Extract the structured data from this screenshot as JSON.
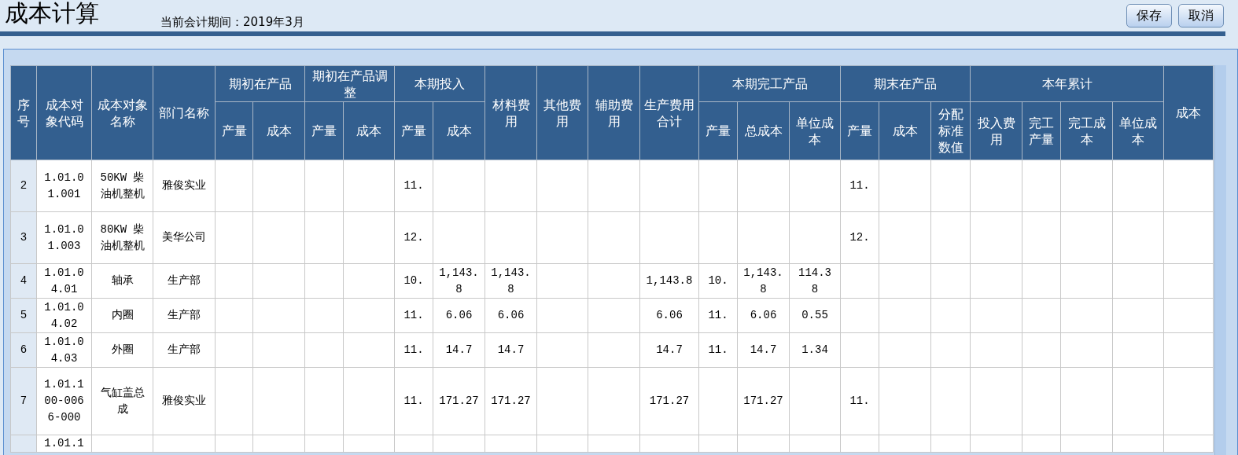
{
  "title": "成本计算",
  "period": "当前会计期间：2019年3月",
  "buttons": [
    "保存",
    "取消"
  ],
  "table": {
    "header": [
      {
        "label": "序号"
      },
      {
        "label": "成本对象代码"
      },
      {
        "label": "成本对象名称"
      },
      {
        "label": "部门名称"
      },
      {
        "label": "期初在产品",
        "children": [
          "产量",
          "成本"
        ]
      },
      {
        "label": "期初在产品调整",
        "children": [
          "产量",
          "成本"
        ]
      },
      {
        "label": "本期投入",
        "children": [
          "产量",
          "成本"
        ]
      },
      {
        "label": "材料费用"
      },
      {
        "label": "其他费用"
      },
      {
        "label": "辅助费用"
      },
      {
        "label": "生产费用合计"
      },
      {
        "label": "本期完工产品",
        "children": [
          "产量",
          "总成本",
          "单位成本"
        ]
      },
      {
        "label": "期末在产品",
        "children": [
          "产量",
          "成本",
          "分配标准数值"
        ]
      },
      {
        "label": "本年累计",
        "children": [
          "投入费用",
          "完工产量",
          "完工成本",
          "单位成本"
        ]
      },
      {
        "label": "成本"
      }
    ],
    "rows": [
      {
        "cells": [
          "2",
          "1.01.01.001",
          "50KW 柴油机整机",
          "雅俊实业",
          null,
          null,
          null,
          null,
          "11.",
          null,
          null,
          null,
          null,
          null,
          null,
          null,
          null,
          "11.",
          null,
          null,
          null,
          null,
          null,
          null,
          null
        ]
      },
      {
        "cells": [
          "3",
          "1.01.01.003",
          "80KW 柴油机整机",
          "美华公司",
          null,
          null,
          null,
          null,
          "12.",
          null,
          null,
          null,
          null,
          null,
          null,
          null,
          null,
          "12.",
          null,
          null,
          null,
          null,
          null,
          null,
          null
        ]
      },
      {
        "cells": [
          "4",
          "1.01.04.01",
          "轴承",
          "生产部",
          null,
          null,
          null,
          null,
          "10.",
          "1,143.8",
          "1,143.8",
          null,
          null,
          "1,143.8",
          "10.",
          "1,143.8",
          "114.38",
          null,
          null,
          null,
          null,
          null,
          null,
          null,
          null
        ]
      },
      {
        "cells": [
          "5",
          "1.01.04.02",
          "内圈",
          "生产部",
          null,
          null,
          null,
          null,
          "11.",
          "6.06",
          "6.06",
          null,
          null,
          "6.06",
          "11.",
          "6.06",
          "0.55",
          null,
          null,
          null,
          null,
          null,
          null,
          null,
          null
        ]
      },
      {
        "cells": [
          "6",
          "1.01.04.03",
          "外圈",
          "生产部",
          null,
          null,
          null,
          null,
          "11.",
          "14.7",
          "14.7",
          null,
          null,
          "14.7",
          "11.",
          "14.7",
          "1.34",
          null,
          null,
          null,
          null,
          null,
          null,
          null,
          null
        ]
      },
      {
        "cells": [
          "7",
          "1.01.100-0066-000",
          "气缸盖总成",
          "雅俊实业",
          null,
          null,
          null,
          null,
          "11.",
          "171.27",
          "171.27",
          null,
          null,
          "171.27",
          null,
          "171.27",
          null,
          "11.",
          null,
          null,
          null,
          null,
          null,
          null,
          null
        ]
      },
      {
        "cells": [
          null,
          "1.01.1",
          null,
          null,
          null,
          null,
          null,
          null,
          null,
          null,
          null,
          null,
          null,
          null,
          null,
          null,
          null,
          null,
          null,
          null,
          null,
          null,
          null,
          null,
          null
        ]
      }
    ]
  }
}
